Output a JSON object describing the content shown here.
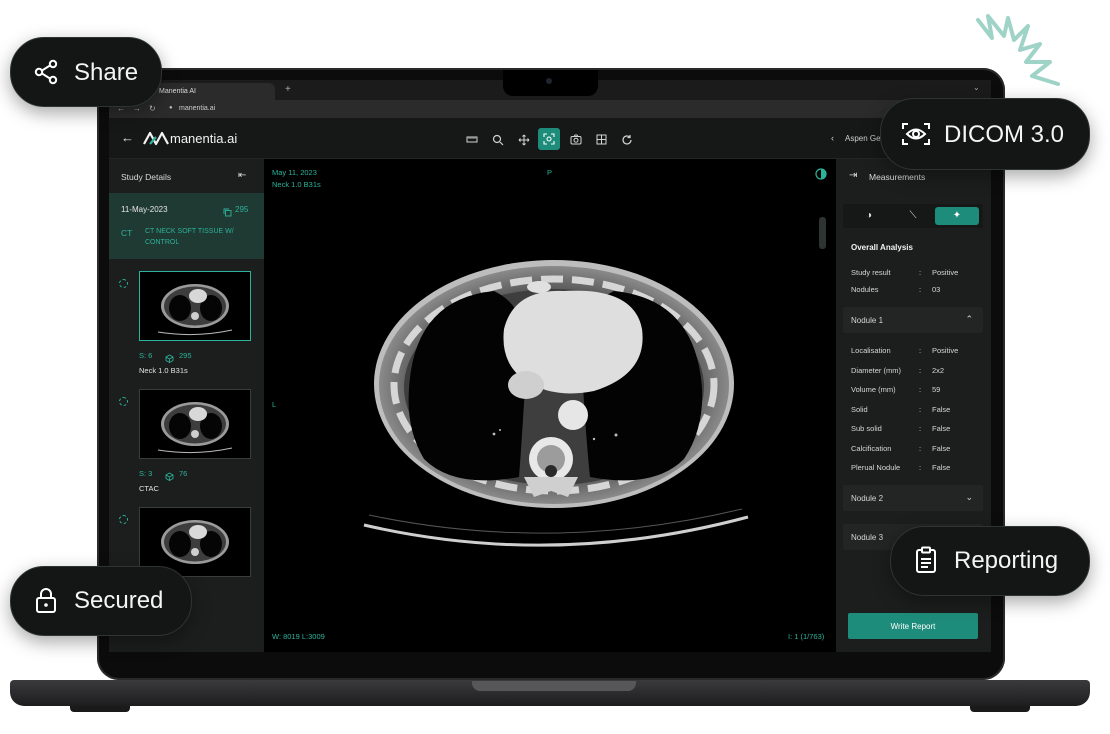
{
  "browser": {
    "tab_title": "Manentia AI",
    "new_tab": "+",
    "url": "manentia.ai"
  },
  "app": {
    "logo_text": "manentia.ai",
    "patient_name": "Aspen Ge",
    "toolbar_icons": [
      "ruler-icon",
      "zoom-icon",
      "pan-icon",
      "ai-scan-icon",
      "camera-icon",
      "grid-icon",
      "reset-icon"
    ],
    "active_tool": "ai-scan-icon"
  },
  "study_panel": {
    "header": "Study Details",
    "study": {
      "date": "11-May-2023",
      "image_count": "295",
      "modality": "CT",
      "description": "CT NECK SOFT TISSUE W/ CONTROL"
    },
    "series": [
      {
        "series_no": "S: 6",
        "count": "295",
        "name": "Neck 1.0 B31s",
        "selected": true
      },
      {
        "series_no": "S: 3",
        "count": "76",
        "name": "CTAC",
        "selected": false
      },
      {
        "series_no": "",
        "count": "",
        "name": "",
        "selected": false
      }
    ]
  },
  "viewer": {
    "date": "May 11, 2023",
    "series_name": "Neck 1.0 B31s",
    "orientation_top": "P",
    "orientation_left": "L",
    "window_level": "W: 8019 L:3009",
    "image_index": "I: 1 (1/763)"
  },
  "measurements": {
    "header": "Measurements",
    "overall_title": "Overall Analysis",
    "overall": [
      {
        "label": "Study result",
        "value": "Positive"
      },
      {
        "label": "Nodules",
        "value": "03"
      }
    ],
    "nodules": [
      {
        "title": "Nodule 1",
        "expanded": true,
        "details": [
          {
            "label": "Localisation",
            "value": "Positive"
          },
          {
            "label": "Diameter (mm)",
            "value": "2x2"
          },
          {
            "label": "Volume (mm)",
            "value": "59"
          },
          {
            "label": "Solid",
            "value": "False"
          },
          {
            "label": "Sub solid",
            "value": "False"
          },
          {
            "label": "Calcification",
            "value": "False"
          },
          {
            "label": "Plerual Nodule",
            "value": "False"
          }
        ]
      },
      {
        "title": "Nodule 2",
        "expanded": false
      },
      {
        "title": "Nodule 3",
        "expanded": false
      }
    ],
    "separator": ":",
    "write_report": "Write Report"
  },
  "badges": {
    "share": "Share",
    "dicom": "DICOM 3.0",
    "secured": "Secured",
    "reporting": "Reporting"
  },
  "colors": {
    "accent": "#1e8c7a",
    "accent_text": "#2cb39b",
    "panel": "#1c1e1d",
    "squiggle": "#9fd3c7"
  }
}
